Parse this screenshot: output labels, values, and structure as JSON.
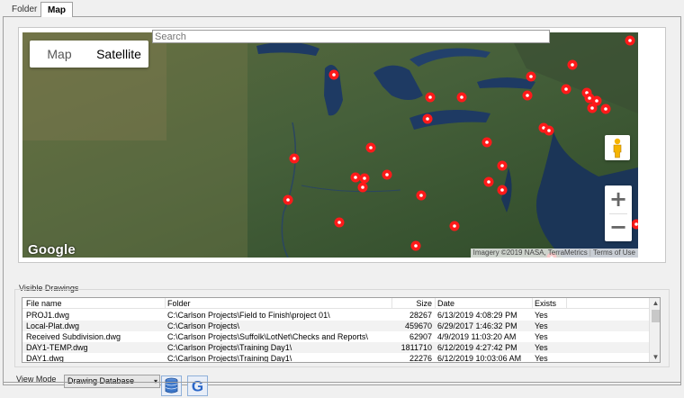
{
  "tabs": [
    {
      "label": "Folder"
    },
    {
      "label": "Map"
    }
  ],
  "map": {
    "search_placeholder": "Search",
    "type_map": "Map",
    "type_satellite": "Satellite",
    "selected_type": "Satellite",
    "google_logo": "Google",
    "attribution": "Imagery ©2019 NASA, TerraMetrics",
    "terms": "Terms of Use",
    "zoom_in": "+",
    "zoom_out": "−",
    "marker_color": "#ff1a1a",
    "icons": [
      "pegman-icon",
      "zoom-in-icon",
      "zoom-out-icon",
      "map-marker-icon"
    ]
  },
  "drawings": {
    "group_label": "Visible Drawings",
    "columns": [
      "File name",
      "Folder",
      "Size",
      "Date",
      "Exists"
    ],
    "rows": [
      {
        "file": "PROJ1.dwg",
        "folder": "C:\\Carlson Projects\\Field to Finish\\project 01\\",
        "size": "28267",
        "date": "6/13/2019 4:08:29 PM",
        "exists": "Yes"
      },
      {
        "file": "Local-Plat.dwg",
        "folder": "C:\\Carlson Projects\\",
        "size": "459670",
        "date": "6/29/2017 1:46:32 PM",
        "exists": "Yes"
      },
      {
        "file": "Received Subdivision.dwg",
        "folder": "C:\\Carlson Projects\\Suffolk\\LotNet\\Checks and Reports\\",
        "size": "62907",
        "date": "4/9/2019 11:03:20 AM",
        "exists": "Yes"
      },
      {
        "file": "DAY1-TEMP.dwg",
        "folder": "C:\\Carlson Projects\\Training Day1\\",
        "size": "1811710",
        "date": "6/12/2019 4:27:42 PM",
        "exists": "Yes"
      },
      {
        "file": "DAY1.dwg",
        "folder": "C:\\Carlson Projects\\Training Day1\\",
        "size": "22276",
        "date": "6/12/2019 10:03:06 AM",
        "exists": "Yes"
      }
    ]
  },
  "view_mode": {
    "label": "View Mode",
    "selected": "Drawing Database",
    "icons": [
      "database-icon",
      "google-icon"
    ]
  }
}
